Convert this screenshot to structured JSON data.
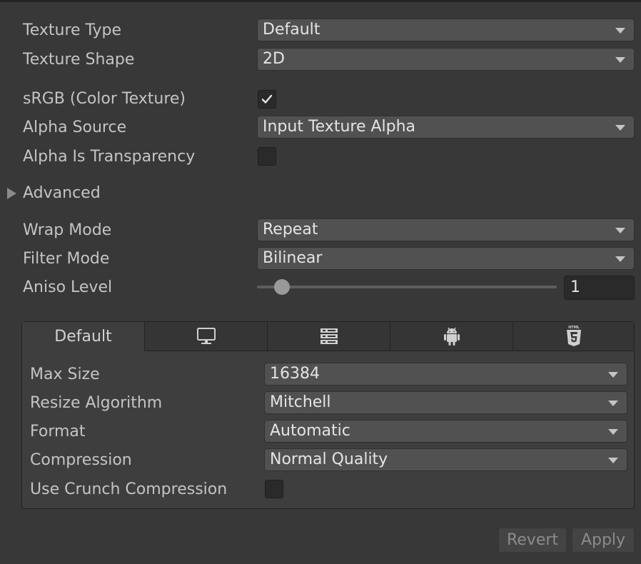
{
  "texture": {
    "type_label": "Texture Type",
    "type_value": "Default",
    "shape_label": "Texture Shape",
    "shape_value": "2D",
    "srgb_label": "sRGB (Color Texture)",
    "srgb_checked": true,
    "alpha_source_label": "Alpha Source",
    "alpha_source_value": "Input Texture Alpha",
    "alpha_transparency_label": "Alpha Is Transparency",
    "alpha_transparency_checked": false
  },
  "advanced": {
    "label": "Advanced",
    "expanded": false
  },
  "sampling": {
    "wrap_label": "Wrap Mode",
    "wrap_value": "Repeat",
    "filter_label": "Filter Mode",
    "filter_value": "Bilinear",
    "aniso_label": "Aniso Level",
    "aniso_value": "1",
    "aniso_min": 0,
    "aniso_max": 16
  },
  "platform_tabs": [
    {
      "label": "Default",
      "icon": "default-tab",
      "active": true
    },
    {
      "label": "",
      "icon": "monitor-icon"
    },
    {
      "label": "",
      "icon": "server-icon"
    },
    {
      "label": "",
      "icon": "android-icon"
    },
    {
      "label": "",
      "icon": "html5-icon",
      "icon_text": "HTML"
    }
  ],
  "platform_settings": {
    "max_size_label": "Max Size",
    "max_size_value": "16384",
    "resize_label": "Resize Algorithm",
    "resize_value": "Mitchell",
    "format_label": "Format",
    "format_value": "Automatic",
    "compression_label": "Compression",
    "compression_value": "Normal Quality",
    "crunch_label": "Use Crunch Compression",
    "crunch_checked": false
  },
  "buttons": {
    "revert": "Revert",
    "apply": "Apply"
  },
  "colors": {
    "background": "#383838",
    "field": "#515151",
    "checkbox": "#2a2a2a",
    "text": "#c4c4c4",
    "value_text": "#e4e4e4"
  }
}
